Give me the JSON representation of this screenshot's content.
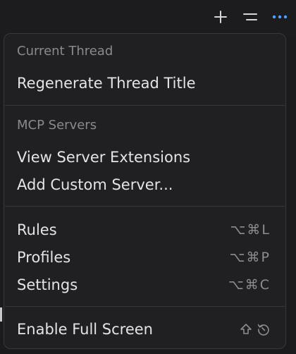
{
  "toolbar": {
    "icons": [
      "plus-icon",
      "list-icon",
      "more-horizontal-icon"
    ],
    "active_color": "#4aa3ff"
  },
  "menu": {
    "sections": [
      {
        "header": "Current Thread",
        "items": [
          {
            "label": "Regenerate Thread Title",
            "shortcut": ""
          }
        ]
      },
      {
        "header": "MCP Servers",
        "items": [
          {
            "label": "View Server Extensions",
            "shortcut": ""
          },
          {
            "label": "Add Custom Server...",
            "shortcut": ""
          }
        ]
      },
      {
        "header": "",
        "items": [
          {
            "label": "Rules",
            "shortcut": "⌥⌘L"
          },
          {
            "label": "Profiles",
            "shortcut": "⌥⌘P"
          },
          {
            "label": "Settings",
            "shortcut": "⌥⌘C"
          }
        ]
      },
      {
        "header": "",
        "items": [
          {
            "label": "Enable Full Screen",
            "shortcut_icons": [
              "shift-icon",
              "restore-icon"
            ]
          }
        ]
      }
    ]
  }
}
